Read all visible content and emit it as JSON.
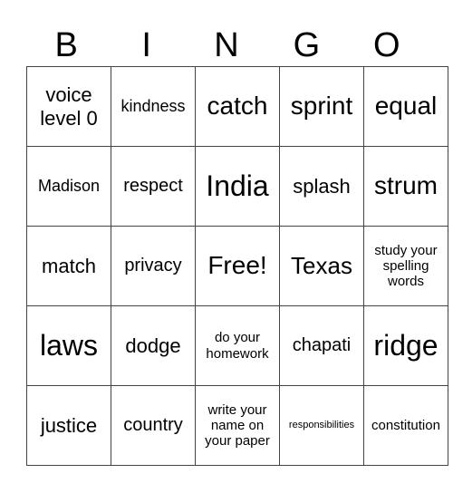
{
  "header": [
    "B",
    "I",
    "N",
    "G",
    "O"
  ],
  "cells": [
    [
      "voice level 0",
      "kindness",
      "catch",
      "sprint",
      "equal"
    ],
    [
      "Madison",
      "respect",
      "India",
      "splash",
      "strum"
    ],
    [
      "match",
      "privacy",
      "Free!",
      "Texas",
      "study your spelling words"
    ],
    [
      "laws",
      "dodge",
      "do your homework",
      "chapati",
      "ridge"
    ],
    [
      "justice",
      "country",
      "write your name on your paper",
      "responsibilities",
      "constitution"
    ]
  ]
}
